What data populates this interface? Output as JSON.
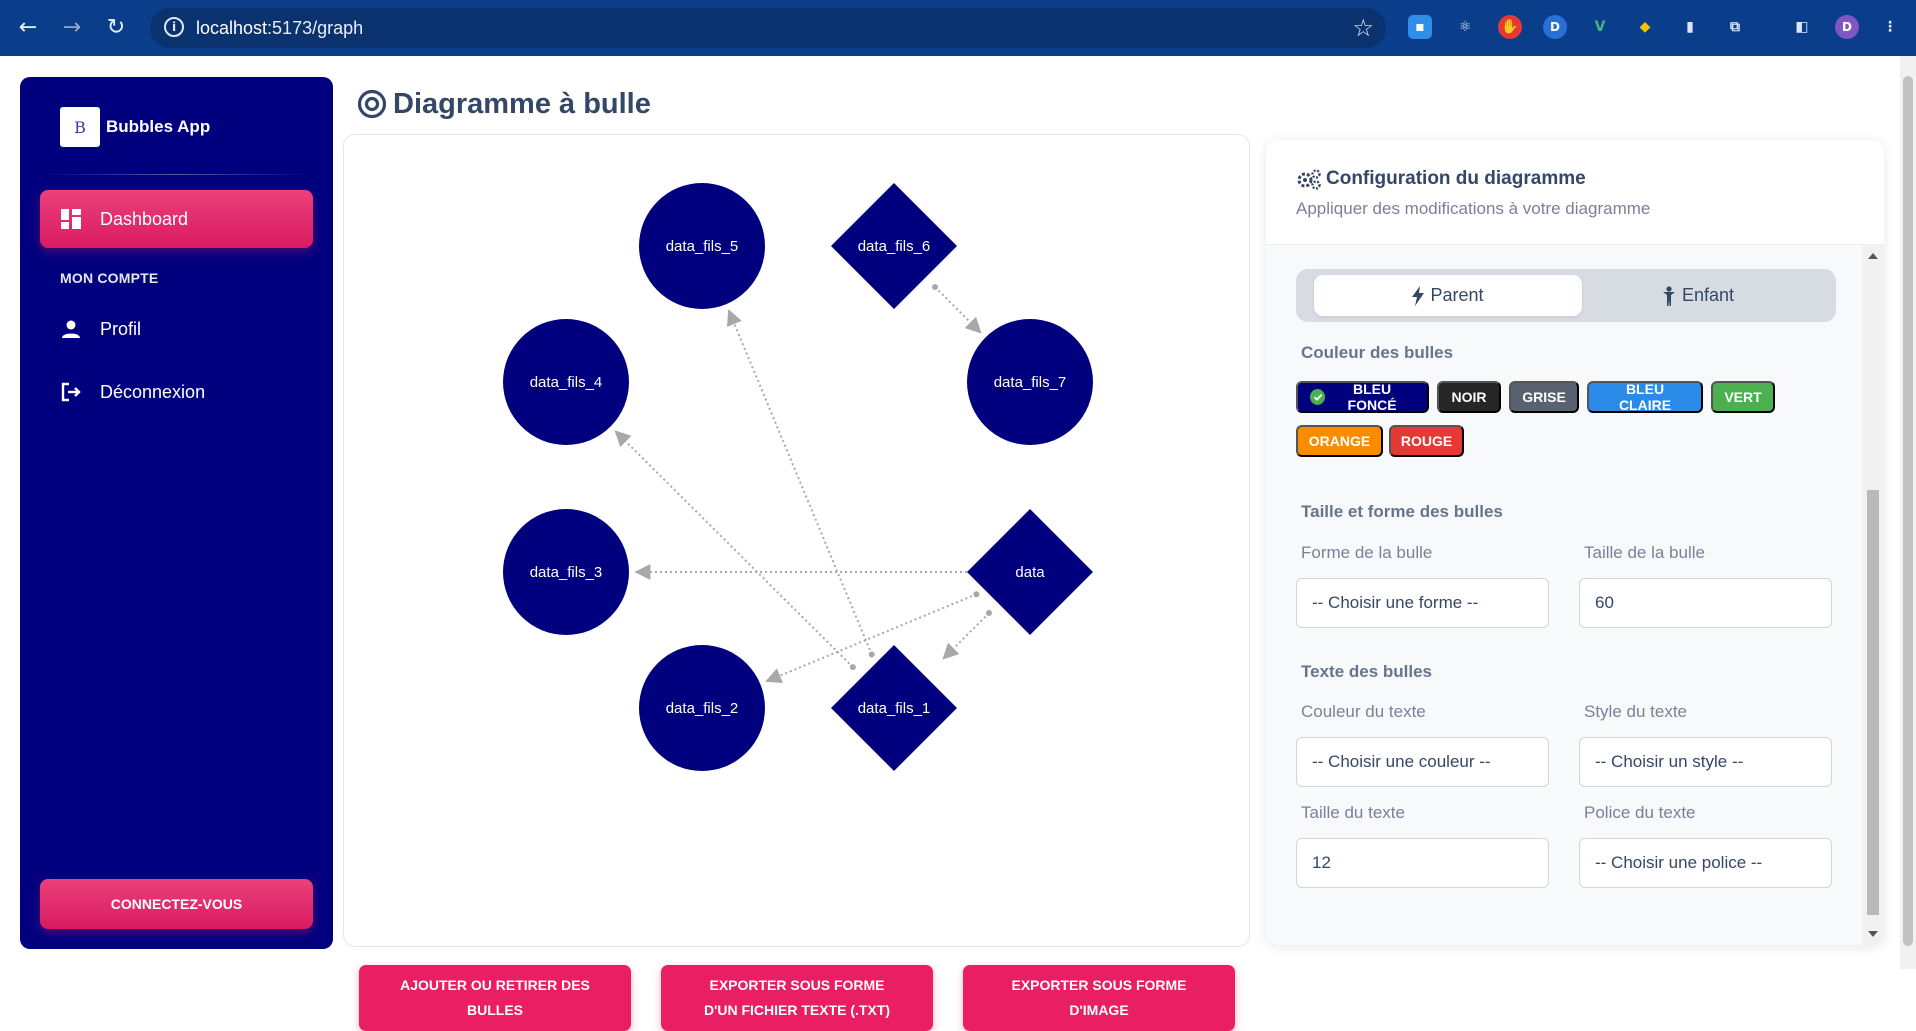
{
  "browser": {
    "url_host": "localhost",
    "url_path": ":5173/graph",
    "profile_initial": "D"
  },
  "sidebar": {
    "brand_name": "Bubbles App",
    "brand_logo_text": "B",
    "section_title": "MON COMPTE",
    "items": [
      {
        "label": "Dashboard",
        "icon": "dashboard-icon",
        "active": true
      },
      {
        "label": "Profil",
        "icon": "person-icon"
      },
      {
        "label": "Déconnexion",
        "icon": "logout-icon"
      }
    ],
    "connect_label": "CONNECTEZ-VOUS"
  },
  "page": {
    "title": "Diagramme à bulle"
  },
  "graph": {
    "nodes": [
      {
        "id": "data",
        "label": "data",
        "shape": "diamond"
      },
      {
        "id": "data_fils_1",
        "label": "data_fils_1",
        "shape": "diamond"
      },
      {
        "id": "data_fils_2",
        "label": "data_fils_2",
        "shape": "circle"
      },
      {
        "id": "data_fils_3",
        "label": "data_fils_3",
        "shape": "circle"
      },
      {
        "id": "data_fils_4",
        "label": "data_fils_4",
        "shape": "circle"
      },
      {
        "id": "data_fils_5",
        "label": "data_fils_5",
        "shape": "circle"
      },
      {
        "id": "data_fils_6",
        "label": "data_fils_6",
        "shape": "diamond"
      },
      {
        "id": "data_fils_7",
        "label": "data_fils_7",
        "shape": "circle"
      }
    ],
    "edges": [
      {
        "from": "data",
        "to": "data_fils_3"
      },
      {
        "from": "data",
        "to": "data_fils_2"
      },
      {
        "from": "data",
        "to": "data_fils_1"
      },
      {
        "from": "data_fils_1",
        "to": "data_fils_4"
      },
      {
        "from": "data_fils_1",
        "to": "data_fils_5"
      },
      {
        "from": "data_fils_6",
        "to": "data_fils_7"
      }
    ],
    "node_color": "#00007f",
    "edge_color": "#a8a8a8"
  },
  "actions": {
    "add_remove": "AJOUTER OU RETIRER DES BULLES",
    "export_txt": "EXPORTER SOUS FORME D'UN FICHIER TEXTE (.TXT)",
    "export_image": "EXPORTER SOUS FORME D'IMAGE"
  },
  "config": {
    "title": "Configuration du diagramme",
    "subtitle": "Appliquer des modifications à votre diagramme",
    "tabs": {
      "parent": "Parent",
      "child": "Enfant"
    },
    "colors_section": "Couleur des bulles",
    "colors": [
      {
        "label": "BLEU FONCÉ",
        "color": "#00007f",
        "selected": true
      },
      {
        "label": "NOIR",
        "color": "#262626"
      },
      {
        "label": "GRISE",
        "color": "#5a6270"
      },
      {
        "label": "BLEU CLAIRE",
        "color": "#2a8ae8"
      },
      {
        "label": "VERT",
        "color": "#4caf50"
      },
      {
        "label": "ORANGE",
        "color": "#fb8c00"
      },
      {
        "label": "ROUGE",
        "color": "#e53935"
      }
    ],
    "size_section": "Taille et forme des bulles",
    "shape_label": "Forme de la bulle",
    "shape_value": "-- Choisir une forme --",
    "size_label": "Taille de la bulle",
    "size_value": "60",
    "text_section": "Texte des bulles",
    "text_color_label": "Couleur du texte",
    "text_color_value": "-- Choisir une couleur --",
    "text_style_label": "Style du texte",
    "text_style_value": "-- Choisir un style --",
    "text_size_label": "Taille du texte",
    "text_size_value": "12",
    "text_font_label": "Police du texte",
    "text_font_value": "-- Choisir une police --"
  }
}
